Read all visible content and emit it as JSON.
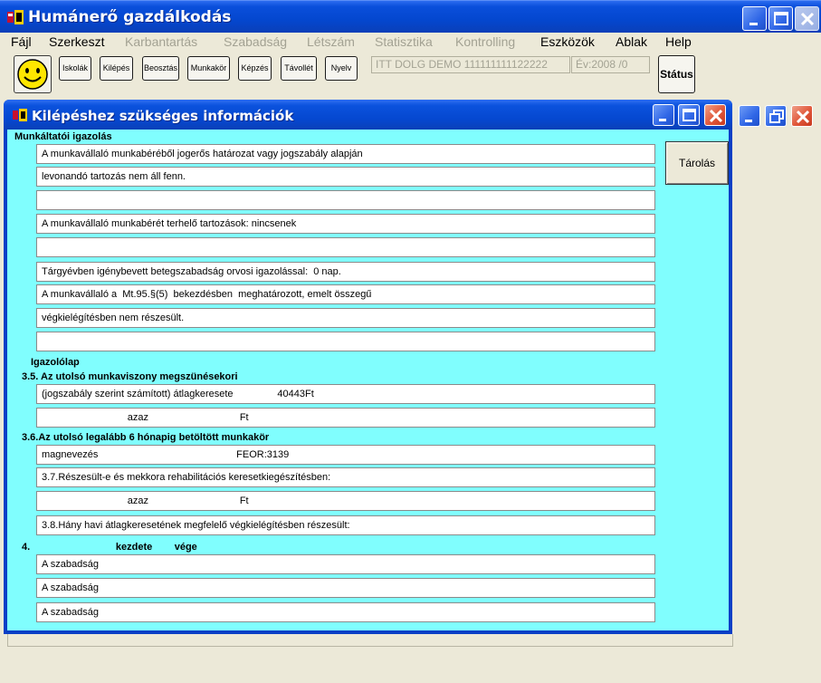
{
  "app": {
    "title": "Humánerő gazdálkodás"
  },
  "menu": [
    {
      "label": "Fájl",
      "enabled": true
    },
    {
      "label": "Szerkeszt",
      "enabled": true
    },
    {
      "label": "Karbantartás",
      "enabled": false
    },
    {
      "label": "Szabadság",
      "enabled": false
    },
    {
      "label": "Létszám",
      "enabled": false
    },
    {
      "label": "Statisztika",
      "enabled": false
    },
    {
      "label": "Kontrolling",
      "enabled": false
    },
    {
      "label": "Eszközök",
      "enabled": true
    },
    {
      "label": "Ablak",
      "enabled": true
    },
    {
      "label": "Help",
      "enabled": true
    }
  ],
  "toolbar": {
    "buttons": [
      "Iskolák",
      "Kilépés",
      "Beosztás",
      "Munkakör",
      "Képzés",
      "Távollét",
      "Nyelv"
    ],
    "company": "ITT DOLG DEMO 111111111122222",
    "year": "Év:2008  /0",
    "status_label": "Státus"
  },
  "child_window": {
    "title": "Kilépéshez szükséges információk",
    "store_label": "Tárolás",
    "employer_heading": "Munkáltatói igazolás",
    "employer_lines": [
      "A munkavállaló munkabéréből jogerős határozat vagy jogszabály alapján",
      "levonandó tartozás nem áll fenn.",
      "",
      "A munkavállaló munkabérét terhelő tartozások: nincsenek",
      "",
      "Tárgyévben igénybevett betegszabadság orvosi igazolással:  0 nap.",
      "A munkavállaló a  Mt.95.§(5)  bekezdésben  meghatározott, emelt összegű",
      "végkielégítésben nem részesült.",
      ""
    ],
    "certificate_heading": "Igazolólap",
    "section_35_heading": "3.5. Az utolsó munkaviszony megszünésekori",
    "section_35_lines": [
      "(jogszabály szerint számított) átlagkeresete                40443Ft",
      "                               azaz                                 Ft"
    ],
    "section_36_heading": "3.6.Az utolsó legalább 6 hónapig betöltött munkakör",
    "section_36_lines": [
      "magnevezés                                                  FEOR:3139",
      "3.7.Részesült-e és mekkora rehabilitációs keresetkiegészítésben:",
      "                               azaz                                 Ft",
      "3.8.Hány havi átlagkeresetének megfelelő végkielégítésben részesült:"
    ],
    "section_4_heading": "4.                               kezdete        vége",
    "section_4_lines": [
      "A szabadság",
      "A szabadság",
      "A szabadság"
    ]
  }
}
